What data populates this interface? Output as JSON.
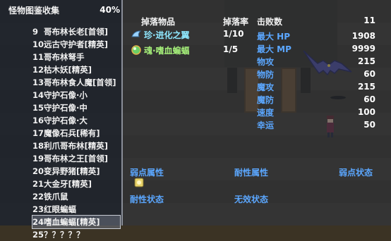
{
  "compendium": {
    "title": "怪物图鉴收集",
    "progress_text": "40%",
    "progress": 0.4,
    "monsters": [
      {
        "num": "9",
        "name": "哥布林长老[首领]"
      },
      {
        "num": "10",
        "name": "远古守护者[精英]"
      },
      {
        "num": "11",
        "name": "哥布林弩手"
      },
      {
        "num": "12",
        "name": "枯木妖[精英]"
      },
      {
        "num": "13",
        "name": "哥布林食人魔[首领]"
      },
      {
        "num": "14",
        "name": "守护石像·小"
      },
      {
        "num": "15",
        "name": "守护石像·中"
      },
      {
        "num": "16",
        "name": "守护石像·大"
      },
      {
        "num": "17",
        "name": "魔像石兵[稀有]"
      },
      {
        "num": "18",
        "name": "利爪哥布林[精英]"
      },
      {
        "num": "19",
        "name": "哥布林之王[首领]"
      },
      {
        "num": "20",
        "name": "变异野猪[精英]"
      },
      {
        "num": "21",
        "name": "大金牙[精英]"
      },
      {
        "num": "22",
        "name": "铁爪鼠"
      },
      {
        "num": "23",
        "name": "红眼蝙蝠"
      },
      {
        "num": "24",
        "name": "嗜血蝙蝠[精英]"
      },
      {
        "num": "25",
        "name": "？？？？？"
      }
    ],
    "selected_index": 15
  },
  "detail": {
    "headers": {
      "drops": "掉落物品",
      "rate": "掉落率",
      "kills": "击败数"
    },
    "kills_value": "11",
    "drops": [
      {
        "name": "珍·进化之翼",
        "rate": "1/10",
        "color": "#8fe8ff"
      },
      {
        "name": "魂·嗜血蝙蝠",
        "rate": "1/5",
        "color": "#a6f07a"
      }
    ],
    "stats": [
      {
        "label": "最大 HP",
        "value": "1908"
      },
      {
        "label": "最大 MP",
        "value": "9999"
      },
      {
        "label": "物攻",
        "value": "215"
      },
      {
        "label": "物防",
        "value": "60"
      },
      {
        "label": "魔攻",
        "value": "215"
      },
      {
        "label": "魔防",
        "value": "60"
      },
      {
        "label": "速度",
        "value": "100"
      },
      {
        "label": "幸运",
        "value": "50"
      }
    ],
    "sections": {
      "weak_attr": "弱点属性",
      "resist_attr": "耐性属性",
      "weak_state": "弱点状态",
      "resist_state": "耐性状态",
      "immune_state": "无效状态"
    }
  }
}
